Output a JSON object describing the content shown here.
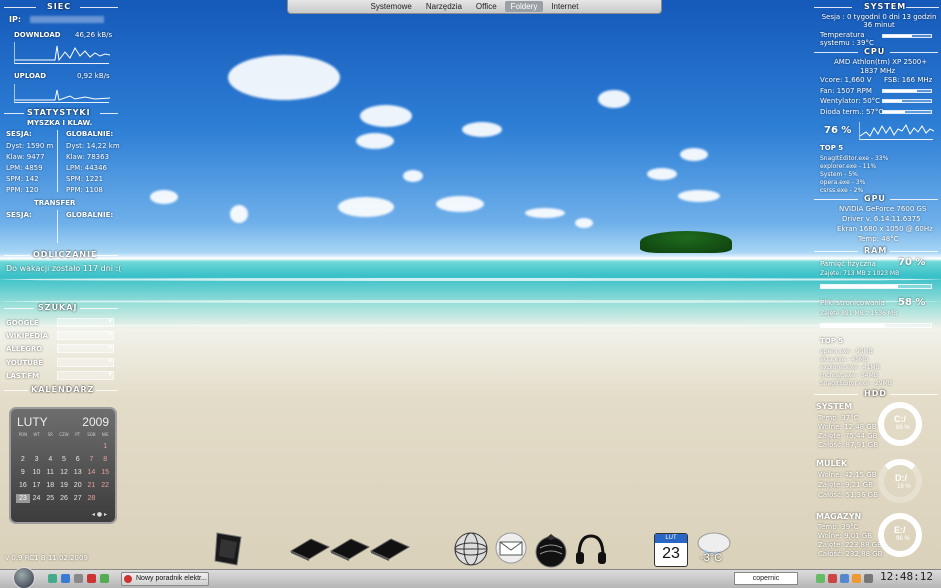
{
  "topnav": {
    "items": [
      {
        "label": "Systemowe",
        "active": false
      },
      {
        "label": "Narzędzia",
        "active": false
      },
      {
        "label": "Office",
        "active": false
      },
      {
        "label": "Foldery",
        "active": true
      },
      {
        "label": "Internet",
        "active": false
      }
    ]
  },
  "left": {
    "siec": {
      "title": "SIEC",
      "ip_label": "IP:",
      "download_label": "DOWNLOAD",
      "download_value": "46,26 kB/s",
      "upload_label": "UPLOAD",
      "upload_value": "0,92 kB/s"
    },
    "stat": {
      "title": "STATYSTYKI",
      "sub": "MYSZKA I KLAW.",
      "sesja": "SESJA:",
      "globalnie": "GLOBALNIE:",
      "sesja_rows": [
        "Dyst: 1590 m",
        "Klaw: 9477",
        "LPM: 4859",
        "SPM: 142",
        "PPM: 120"
      ],
      "glob_rows": [
        "Dyst: 14,22 km",
        "Klaw: 78363",
        "LPM: 44346",
        "SPM: 1221",
        "PPM: 1108"
      ],
      "transfer": "TRANSFER",
      "t_sesja": "SESJA:",
      "t_glob": "GLOBALNIE:"
    },
    "odliczanie": {
      "title": "ODLICZANIE",
      "text": "Do wakacji zostało 117 dni :("
    },
    "szukaj": {
      "title": "SZUKAJ",
      "engines": [
        "GOOGLE",
        "WIKIPEDIA",
        "ALLEGRO",
        "YOUTUBE",
        "LAST.FM"
      ]
    },
    "kalendarz": {
      "title": "KALENDARZ",
      "month": "LUTY",
      "year": "2009",
      "days": [
        "PON",
        "WT",
        "ŚR",
        "CZW",
        "PT",
        "SOB",
        "NIE"
      ],
      "cells": [
        "",
        "",
        "",
        "",
        "",
        "",
        "1",
        "2",
        "3",
        "4",
        "5",
        "6",
        "7",
        "8",
        "9",
        "10",
        "11",
        "12",
        "13",
        "14",
        "15",
        "16",
        "17",
        "18",
        "19",
        "20",
        "21",
        "22",
        "23",
        "24",
        "25",
        "26",
        "27",
        "28",
        ""
      ]
    },
    "version": "v 0.9 RC1 B 11.02.2009"
  },
  "right": {
    "system": {
      "title": "SYSTEM",
      "session": "Sesja : 0 tygodni 0 dni 13 godzin 36 minut",
      "temp_label": "Temperatura systemu : 39°C",
      "temp_level": 0.6
    },
    "cpu": {
      "title": "CPU",
      "model": "AMD Athlon(tm) XP 2500+",
      "mhz": "1837 MHz",
      "vcore": "Vcore: 1,660 V",
      "fsb": "FSB: 166 MHz",
      "fan": "Fan: 1507 RPM",
      "went": "Wentylator: 50°C",
      "dioda": "Dioda term.: 57°C",
      "usage": "76 %",
      "top5_title": "TOP 5",
      "top5": [
        "SnagItEditor.exe - 33%",
        "explorer.exe - 11%",
        "System - 5%",
        "opera.exe - 3%",
        "csrss.exe - 2%"
      ]
    },
    "gpu": {
      "title": "GPU",
      "model": "NVIDIA GeForce 7600 GS",
      "driver": "Driver v. 6.14.11.6375",
      "screen": "Ekran 1680 x 1050 @ 60Hz",
      "temp": "Temp: 48°C"
    },
    "ram": {
      "title": "RAM",
      "pam_label": "Pamięć fizyczna",
      "pam_pct": "70 %",
      "pam_used": "Zajęte: 713 MB z 1023 MB",
      "pam_level": 0.7,
      "page_label": "Pliki stronicowania",
      "page_pct": "58 %",
      "page_used": "Zajęte 891 MB z 1536 MB",
      "page_level": 0.58,
      "top5_title": "TOP 5",
      "top5": [
        "opera.exe - 95MB",
        "skra.exe - 45MB",
        "explorer.exe - 41MB",
        "rnchost.exe - 34MB",
        "SnagItEditor.exe - 29MB"
      ]
    },
    "hdd": {
      "title": "HDD",
      "drives": [
        {
          "name": "SYSTEM",
          "temp": "Temp: 37°C",
          "free": "Wolne: 12,48 GB",
          "used": "Zajęte: 75,44 GB",
          "total": "Całość: 87,91 GB",
          "letter": "C:/",
          "pct": "86 %"
        },
        {
          "name": "MULEK",
          "temp": "",
          "free": "Wolne: 42,15 GB",
          "used": "Zajęte: 9,21 GB",
          "total": "Całość: 51,36 GB",
          "letter": "D:/",
          "pct": "18 %"
        },
        {
          "name": "MAGAZYN",
          "temp": "Temp: 39°C",
          "free": "Wolne: 9,01 GB",
          "used": "Zajęte: 223,88 GB",
          "total": "Całość: 232,88 GB",
          "letter": "E:/",
          "pct": "96 %"
        }
      ]
    }
  },
  "dock": {
    "calendar_month": "LUT",
    "calendar_day": "23",
    "weather": "-3°C"
  },
  "taskbar": {
    "task_label": "Nowy poradnik elektr...",
    "search_text": "copernic",
    "clock": "12:48:12"
  }
}
